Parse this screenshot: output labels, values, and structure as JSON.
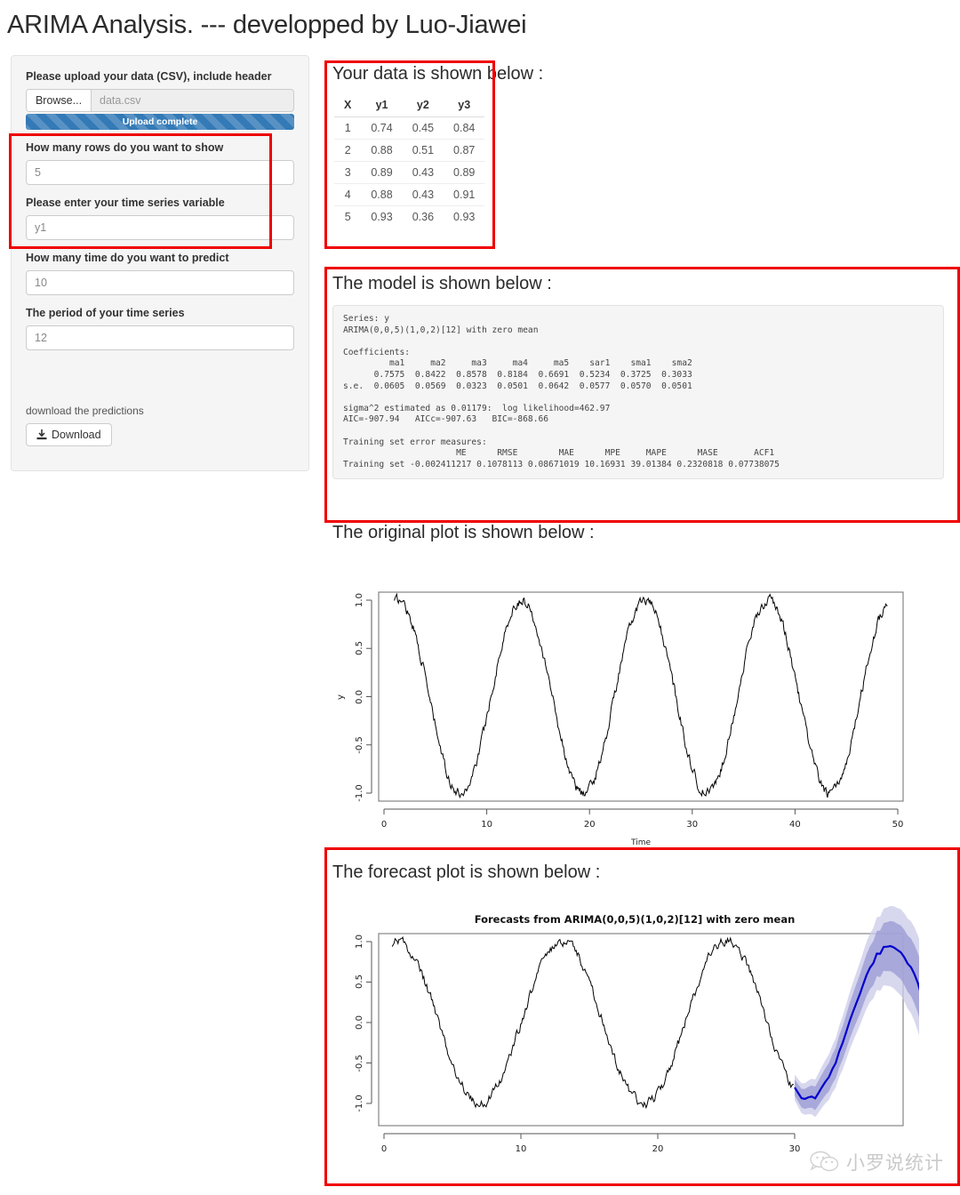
{
  "app_title": "ARIMA Analysis. --- developped by Luo-Jiawei",
  "sidebar": {
    "upload": {
      "label": "Please upload your data (CSV), include header",
      "browse_label": "Browse...",
      "file_name": "data.csv",
      "progress_text": "Upload complete",
      "progress_percent": "100"
    },
    "fields": [
      {
        "label": "How many rows do you want to show",
        "value": "5"
      },
      {
        "label": "Please enter your time series variable",
        "value": "y1"
      },
      {
        "label": "How many time do you want to predict",
        "value": "10"
      },
      {
        "label": "The period of your time series",
        "value": "12"
      }
    ],
    "download": {
      "label": "download the predictions",
      "button_label": "Download",
      "icon": "download-icon"
    }
  },
  "sections": {
    "data_heading": "Your data is shown below :",
    "model_heading": "The model is shown below :",
    "original_plot_heading": "The original plot is shown below :",
    "forecast_plot_heading": "The forecast plot is shown below :"
  },
  "data_table": {
    "columns": [
      "X",
      "y1",
      "y2",
      "y3"
    ],
    "rows": [
      [
        "1",
        "0.74",
        "0.45",
        "0.84"
      ],
      [
        "2",
        "0.88",
        "0.51",
        "0.87"
      ],
      [
        "3",
        "0.89",
        "0.43",
        "0.89"
      ],
      [
        "4",
        "0.88",
        "0.43",
        "0.91"
      ],
      [
        "5",
        "0.93",
        "0.36",
        "0.93"
      ]
    ]
  },
  "model_output": "Series: y\nARIMA(0,0,5)(1,0,2)[12] with zero mean\n\nCoefficients:\n         ma1     ma2     ma3     ma4     ma5    sar1    sma1    sma2\n      0.7575  0.8422  0.8578  0.8184  0.6691  0.5234  0.3725  0.3033\ns.e.  0.0605  0.0569  0.0323  0.0501  0.0642  0.0577  0.0570  0.0501\n\nsigma^2 estimated as 0.01179:  log likelihood=462.97\nAIC=-907.94   AICc=-907.63   BIC=-868.66\n\nTraining set error measures:\n                      ME      RMSE        MAE      MPE     MAPE      MASE       ACF1\nTraining set -0.002411217 0.1078113 0.08671019 10.16931 39.01384 0.2320818 0.07738075",
  "chart_data": [
    {
      "type": "line",
      "name": "original-plot",
      "title": "",
      "xlabel": "Time",
      "ylabel": "y",
      "xticks": [
        "0",
        "10",
        "20",
        "30",
        "40",
        "50"
      ],
      "yticks": [
        "1.0",
        "0.5",
        "0.0",
        "-0.5",
        "-1.0"
      ],
      "xlim": [
        0,
        50
      ],
      "ylim": [
        -1.15,
        1.1
      ],
      "grid": false,
      "legend": "none",
      "series": [
        {
          "name": "y",
          "color": "#000000",
          "description": "noisy sinusoid, period 12, amplitude ~1.0, spanning t=1 to t=49"
        }
      ],
      "period": 12,
      "amplitude": 1.0,
      "noise_sd": 0.05
    },
    {
      "type": "line",
      "name": "forecast-plot",
      "title": "Forecasts from ARIMA(0,0,5)(1,0,2)[12] with zero mean",
      "xlabel": "",
      "ylabel": "",
      "xticks": [
        "0",
        "10",
        "20",
        "30"
      ],
      "yticks": [
        "1.0",
        "0.5",
        "0.0",
        "-0.5",
        "-1.0"
      ],
      "xlim": [
        0,
        38
      ],
      "ylim": [
        -1.45,
        1.2
      ],
      "grid": false,
      "legend": "none",
      "series": [
        {
          "name": "observed",
          "color": "#000000",
          "description": "noisy sinusoid, period 12, amplitude ~1.0, spanning t=1 to t=36"
        },
        {
          "name": "forecast",
          "color": "#0000cd",
          "description": "10-step ahead point forecast rising from about -0.95 to 0.25"
        },
        {
          "name": "prediction-interval-80",
          "color": "#9a9ad2",
          "description": "80% prediction interval band"
        },
        {
          "name": "prediction-interval-95",
          "color": "#c8c8e6",
          "description": "95% prediction interval band"
        }
      ],
      "period": 12,
      "amplitude": 1.0,
      "forecast_horizon": 10
    }
  ],
  "annotations": {
    "highlight_color": "#ef0000",
    "boxes": [
      "inputs-rows-and-variable",
      "data-table-panel",
      "model-output-panel",
      "forecast-plot-panel"
    ]
  },
  "watermark": {
    "text": "小罗说统计",
    "icon": "wechat-icon"
  }
}
